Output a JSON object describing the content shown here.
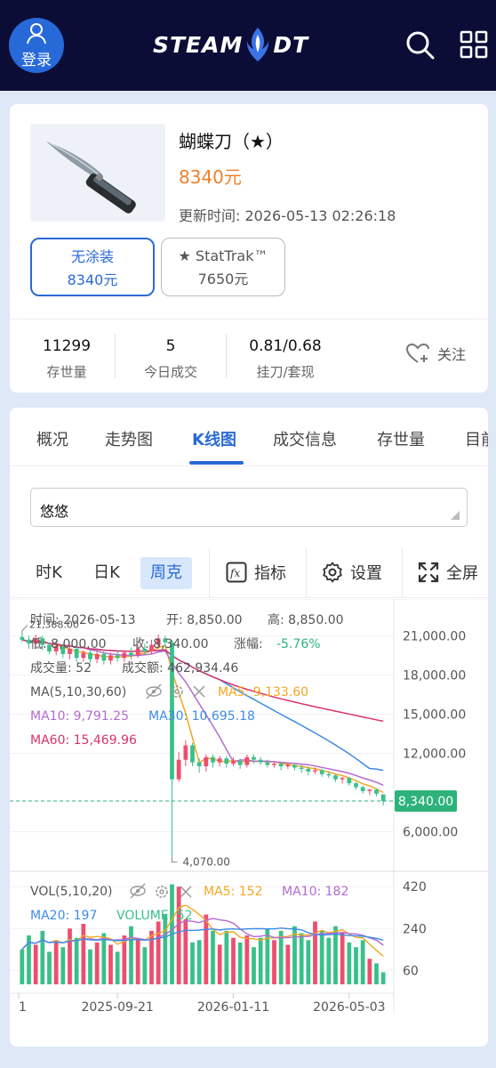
{
  "header": {
    "login_label": "登录",
    "logo_left": "STEAM",
    "logo_right": "DT",
    "icons": [
      "search-icon",
      "grid-icon"
    ]
  },
  "item": {
    "name": "蝴蝶刀（★）",
    "price": "8340元",
    "updated": "更新时间: 2026-05-13 02:26:18",
    "variants": [
      {
        "label": "无涂装",
        "price": "8340元"
      },
      {
        "label": "★ StatTrak™",
        "price": "7650元"
      }
    ],
    "stats": [
      {
        "value": "11299",
        "label": "存世量"
      },
      {
        "value": "5",
        "label": "今日成交"
      },
      {
        "value": "0.81/0.68",
        "label": "挂刀/套现"
      }
    ],
    "follow_label": "关注"
  },
  "tabs": [
    "概况",
    "走势图",
    "K线图",
    "成交信息",
    "存世量",
    "目前"
  ],
  "platform_select": "悠悠",
  "periods": [
    "时K",
    "日K",
    "周克"
  ],
  "tools": [
    {
      "label": "指标",
      "icon": "fx-icon"
    },
    {
      "label": "设置",
      "icon": "gear-icon"
    },
    {
      "label": "全屏",
      "icon": "fullscreen-icon"
    }
  ],
  "info": {
    "time": "时间: 2026-05-13",
    "open": "开: 8,850.00",
    "high": "高: 8,850.00",
    "low": "低: 8,000.00",
    "close": "收: 8,340.00",
    "change_label": "涨幅:",
    "change": "-5.76%",
    "volume": "成交量: 52",
    "amount": "成交额: 462,934.46"
  },
  "ma": {
    "title": "MA(5,10,30,60)",
    "ma5": "MA5: 9,133.60",
    "ma10": "MA10: 9,791.25",
    "ma30": "MA30: 10,695.18",
    "ma60": "MA60: 15,469.96"
  },
  "vol": {
    "title": "VOL(5,10,20)",
    "ma5": "MA5: 152",
    "ma10": "MA10: 182",
    "ma20": "MA20: 197",
    "volume": "VOLUME: 52"
  },
  "colors": {
    "up": "#ee4e6e",
    "down": "#39c08a",
    "ma5": "#f5a623",
    "ma10": "#b36bd1",
    "ma30": "#3d8be6",
    "ma60": "#d6336c",
    "accent": "#2a6ad6",
    "price_orange": "#f0812c"
  },
  "chart_data": {
    "type": "candlestick",
    "price_axis": {
      "ticks": [
        21000,
        18000,
        15000,
        12000,
        6000
      ],
      "tick_labels": [
        "21,000.00",
        "18,000.00",
        "15,000.00",
        "12,000.00",
        "6,000.00"
      ],
      "range": [
        3500,
        23000
      ]
    },
    "last_price": 8340,
    "last_price_label": "8,340.00",
    "max_label": "21,388.00",
    "min_label": "4,070.00",
    "x_labels": [
      "1",
      "2025-09-21",
      "2026-01-11",
      "2026-05-03"
    ],
    "candles": [
      [
        20900,
        20700,
        21388,
        20500
      ],
      [
        20700,
        20400,
        21000,
        20000
      ],
      [
        20400,
        20800,
        21100,
        20100
      ],
      [
        20800,
        20300,
        21000,
        19900
      ],
      [
        20300,
        19800,
        20500,
        19600
      ],
      [
        19800,
        20200,
        20600,
        19500
      ],
      [
        20200,
        19600,
        20400,
        19300
      ],
      [
        19600,
        20000,
        20300,
        19200
      ],
      [
        20000,
        19300,
        20200,
        19000
      ],
      [
        19300,
        19700,
        19900,
        19000
      ],
      [
        19700,
        19200,
        19900,
        18900
      ],
      [
        19200,
        19600,
        19800,
        18900
      ],
      [
        19600,
        19100,
        19800,
        18800
      ],
      [
        19100,
        19500,
        19700,
        18800
      ],
      [
        19500,
        19300,
        19800,
        19000
      ],
      [
        19300,
        19700,
        19900,
        19000
      ],
      [
        19700,
        19500,
        20100,
        19200
      ],
      [
        19500,
        20000,
        20300,
        19300
      ],
      [
        20000,
        19800,
        20400,
        19500
      ],
      [
        19800,
        20300,
        20700,
        19600
      ],
      [
        20300,
        20800,
        21100,
        20000
      ],
      [
        20800,
        20500,
        21000,
        20100
      ],
      [
        20500,
        10000,
        20700,
        4070
      ],
      [
        10000,
        11500,
        12100,
        9800
      ],
      [
        11500,
        12600,
        13000,
        11000
      ],
      [
        12600,
        11300,
        12800,
        11000
      ],
      [
        11300,
        11000,
        11600,
        10500
      ],
      [
        11000,
        11700,
        11900,
        10600
      ],
      [
        11700,
        11300,
        11900,
        10900
      ],
      [
        11300,
        11600,
        11800,
        11000
      ],
      [
        11600,
        11200,
        11800,
        10900
      ],
      [
        11200,
        11400,
        11700,
        11000
      ],
      [
        11400,
        11100,
        11600,
        10800
      ],
      [
        11100,
        11700,
        11900,
        10900
      ],
      [
        11700,
        11500,
        11900,
        11200
      ],
      [
        11500,
        11300,
        11700,
        11100
      ],
      [
        11300,
        11100,
        11500,
        10900
      ],
      [
        11100,
        11200,
        11400,
        10900
      ],
      [
        11200,
        11000,
        11300,
        10700
      ],
      [
        11000,
        11100,
        11300,
        10800
      ],
      [
        11100,
        10900,
        11200,
        10700
      ],
      [
        10900,
        10800,
        11100,
        10500
      ],
      [
        10800,
        10600,
        11000,
        10300
      ],
      [
        10600,
        10700,
        10900,
        10400
      ],
      [
        10700,
        10400,
        10800,
        10200
      ],
      [
        10400,
        10300,
        10600,
        10100
      ],
      [
        10300,
        10000,
        10400,
        9800
      ],
      [
        10000,
        10100,
        10200,
        9700
      ],
      [
        10100,
        9700,
        10200,
        9500
      ],
      [
        9700,
        9400,
        9800,
        9200
      ],
      [
        9400,
        9100,
        9500,
        8900
      ],
      [
        9100,
        9200,
        9300,
        8800
      ],
      [
        9200,
        8900,
        9300,
        8700
      ],
      [
        8850,
        8340,
        8850,
        8000
      ]
    ],
    "volume_axis": {
      "ticks": [
        420,
        240,
        60
      ],
      "range": [
        0,
        440
      ]
    },
    "volumes": [
      150,
      210,
      170,
      230,
      140,
      190,
      160,
      240,
      200,
      260,
      150,
      180,
      220,
      170,
      140,
      210,
      250,
      190,
      160,
      230,
      270,
      300,
      430,
      420,
      280,
      180,
      190,
      300,
      230,
      170,
      230,
      200,
      180,
      210,
      160,
      200,
      240,
      190,
      230,
      170,
      250,
      220,
      190,
      270,
      230,
      200,
      250,
      220,
      180,
      160,
      190,
      110,
      90,
      52
    ]
  }
}
